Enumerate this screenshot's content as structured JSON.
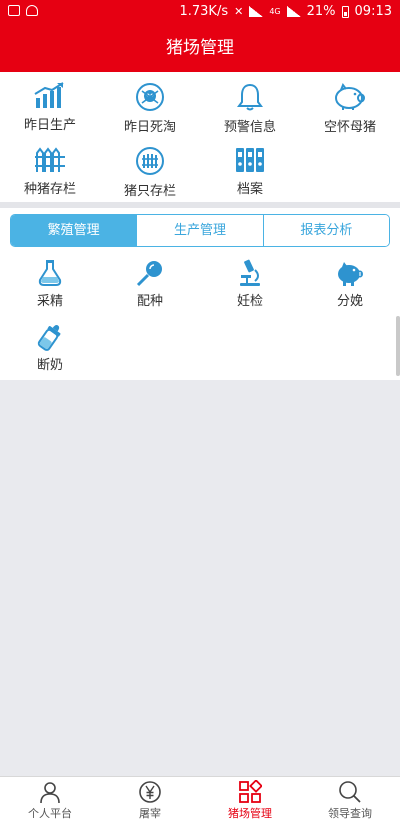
{
  "status_bar": {
    "network_speed": "1.73K/s",
    "network_type": "4G",
    "battery": "21%",
    "time": "09:13"
  },
  "header": {
    "title": "猪场管理"
  },
  "quick_menu": [
    {
      "label": "昨日生产",
      "icon": "production-chart-icon"
    },
    {
      "label": "昨日死淘",
      "icon": "skull-icon"
    },
    {
      "label": "预警信息",
      "icon": "bell-icon"
    },
    {
      "label": "空怀母猪",
      "icon": "pig-icon"
    },
    {
      "label": "种猪存栏",
      "icon": "fence-icon"
    },
    {
      "label": "猪只存栏",
      "icon": "pen-fence-icon"
    },
    {
      "label": "档案",
      "icon": "binder-icon"
    }
  ],
  "tabs": [
    {
      "label": "繁殖管理",
      "active": true
    },
    {
      "label": "生产管理",
      "active": false
    },
    {
      "label": "报表分析",
      "active": false
    }
  ],
  "breeding_menu": [
    {
      "label": "采精",
      "icon": "flask-icon"
    },
    {
      "label": "配种",
      "icon": "syringe-icon"
    },
    {
      "label": "妊检",
      "icon": "microscope-icon"
    },
    {
      "label": "分娩",
      "icon": "piglet-icon"
    },
    {
      "label": "断奶",
      "icon": "baby-bottle-icon"
    }
  ],
  "bottom_nav": [
    {
      "label": "个人平台",
      "icon": "person-icon",
      "active": false
    },
    {
      "label": "屠宰",
      "icon": "yen-icon",
      "active": false
    },
    {
      "label": "猪场管理",
      "icon": "grid-icon",
      "active": true
    },
    {
      "label": "领导查询",
      "icon": "search-icon",
      "active": false
    }
  ],
  "colors": {
    "brand_red": "#e60012",
    "accent_blue": "#4bb3e4",
    "icon_blue": "#2e93cf"
  }
}
